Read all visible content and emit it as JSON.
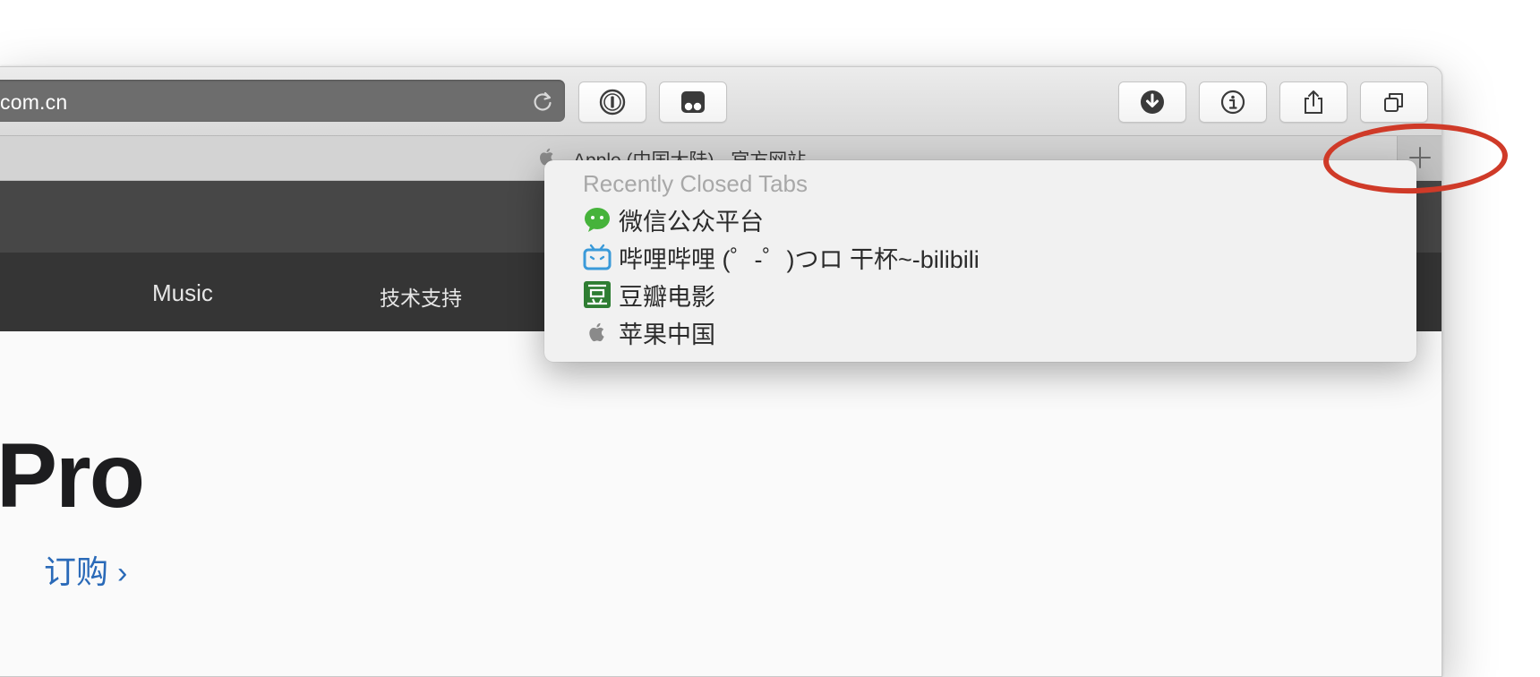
{
  "browser": {
    "address": "com.cn",
    "toolbar_buttons": [
      {
        "name": "1password-button",
        "icon": "1password-icon"
      },
      {
        "name": "ghostery-button",
        "icon": "ghostery-icon"
      },
      {
        "name": "downloads-button",
        "icon": "download-icon"
      },
      {
        "name": "info-button",
        "icon": "info-icon"
      },
      {
        "name": "share-button",
        "icon": "share-icon"
      },
      {
        "name": "tab-overview-button",
        "icon": "tabs-icon"
      }
    ],
    "active_tab": {
      "title": "Apple (中国大陆) - 官方网站",
      "icon": "apple-icon"
    },
    "new_tab_button": {
      "icon": "plus-icon"
    }
  },
  "page": {
    "subnav": [
      "Music",
      "技术支持"
    ],
    "hero_title": "Pro",
    "order_link": "订购",
    "order_chevron": "›"
  },
  "recently_closed": {
    "header": "Recently Closed Tabs",
    "items": [
      {
        "label": "微信公众平台",
        "icon": "wechat-icon",
        "color": "#46b33b"
      },
      {
        "label": "哔哩哔哩 (゜-゜)つロ 干杯~-bilibili",
        "icon": "bilibili-icon",
        "color": "#3a9ad9"
      },
      {
        "label": "豆瓣电影",
        "icon": "douban-icon",
        "color": "#2e7d32"
      },
      {
        "label": "苹果中国",
        "icon": "apple-icon",
        "color": "#8a8a8a"
      }
    ]
  },
  "colors": {
    "annotation_ring": "#cf3a28",
    "link": "#2a6ab8",
    "nav_dark": "#353535"
  }
}
